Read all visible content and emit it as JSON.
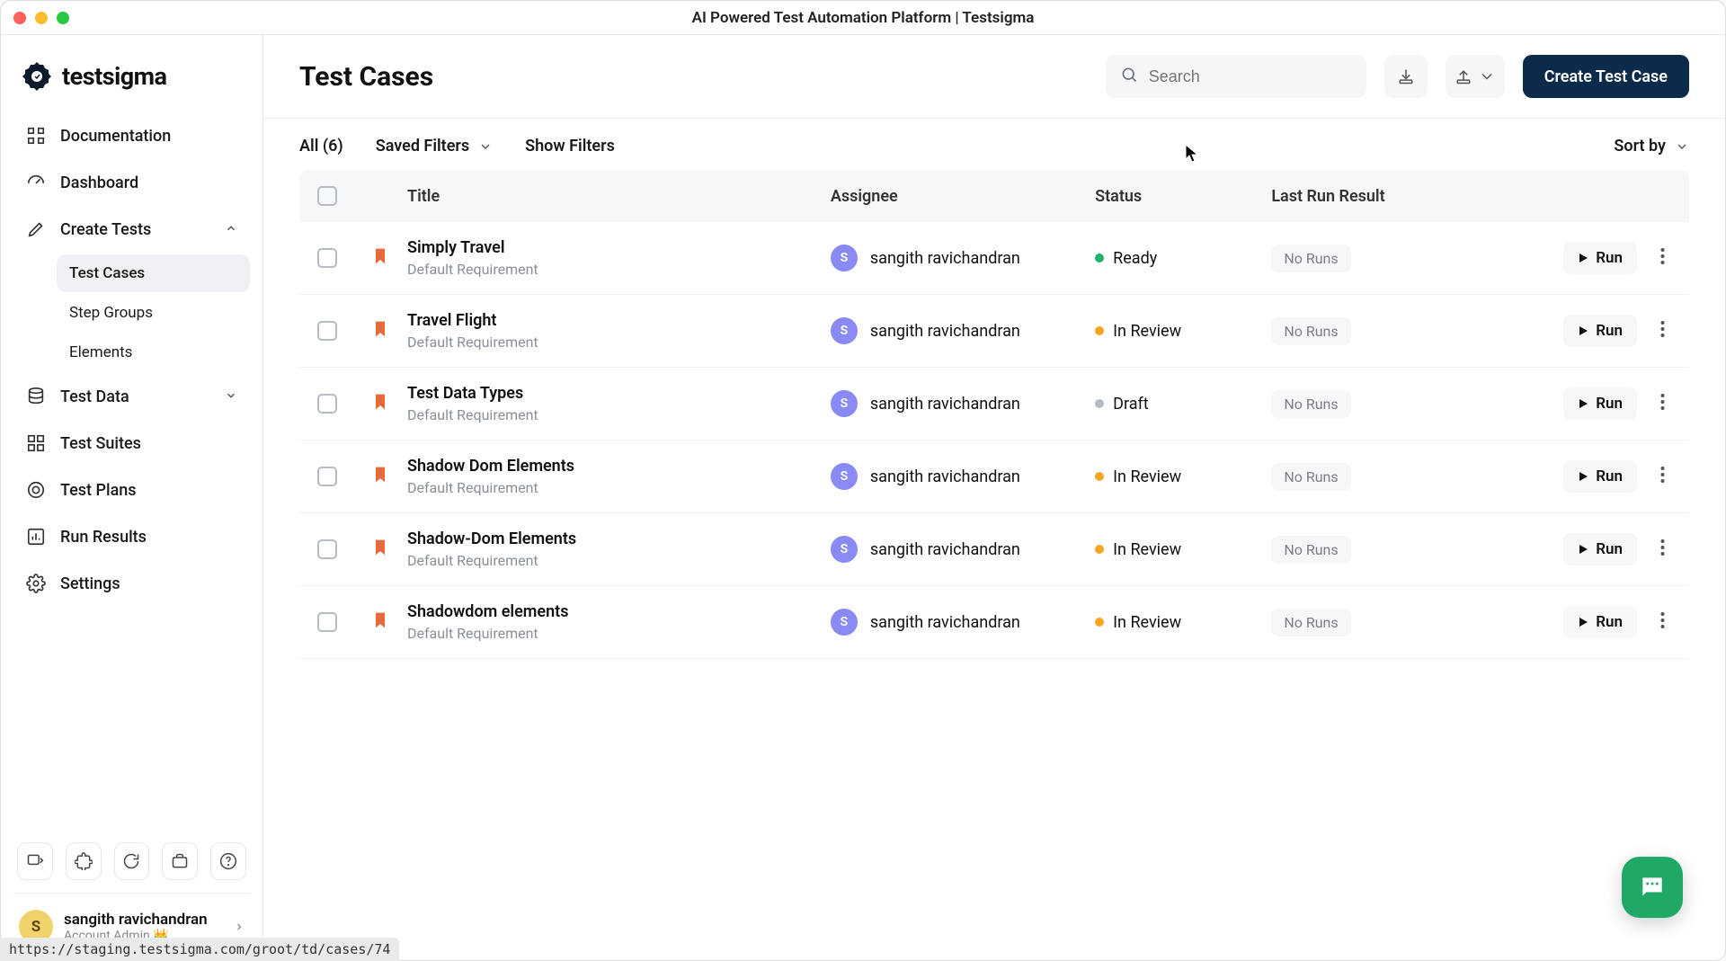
{
  "window": {
    "title": "AI Powered Test Automation Platform | Testsigma"
  },
  "brand": {
    "name": "testsigma"
  },
  "sidebar": {
    "top": [
      {
        "label": "Documentation"
      },
      {
        "label": "Dashboard"
      }
    ],
    "create_tests": {
      "label": "Create Tests"
    },
    "create_tests_children": [
      {
        "label": "Test Cases"
      },
      {
        "label": "Step Groups"
      },
      {
        "label": "Elements"
      }
    ],
    "test_data": {
      "label": "Test Data"
    },
    "rest": [
      {
        "label": "Test Suites"
      },
      {
        "label": "Test Plans"
      },
      {
        "label": "Run Results"
      },
      {
        "label": "Settings"
      }
    ]
  },
  "user": {
    "initial": "S",
    "name": "sangith ravichandran",
    "role": "Account Admin 👑"
  },
  "header": {
    "title": "Test Cases",
    "search_placeholder": "Search",
    "create_btn": "Create Test Case"
  },
  "toolbar": {
    "all": "All (6)",
    "saved_filters": "Saved Filters",
    "show_filters": "Show Filters",
    "sort_by": "Sort by"
  },
  "columns": {
    "title": "Title",
    "assignee": "Assignee",
    "status": "Status",
    "last_run": "Last Run Result"
  },
  "rows": [
    {
      "title": "Simply Travel",
      "sub": "Default Requirement",
      "assignee_initial": "S",
      "assignee": "sangith ravichandran",
      "status": "Ready",
      "status_kind": "ready",
      "result": "No Runs",
      "run": "Run"
    },
    {
      "title": "Travel Flight",
      "sub": "Default Requirement",
      "assignee_initial": "S",
      "assignee": "sangith ravichandran",
      "status": "In Review",
      "status_kind": "review",
      "result": "No Runs",
      "run": "Run"
    },
    {
      "title": "Test Data Types",
      "sub": "Default Requirement",
      "assignee_initial": "S",
      "assignee": "sangith ravichandran",
      "status": "Draft",
      "status_kind": "draft",
      "result": "No Runs",
      "run": "Run"
    },
    {
      "title": "Shadow Dom Elements",
      "sub": "Default Requirement",
      "assignee_initial": "S",
      "assignee": "sangith ravichandran",
      "status": "In Review",
      "status_kind": "review",
      "result": "No Runs",
      "run": "Run"
    },
    {
      "title": "Shadow-Dom Elements",
      "sub": "Default Requirement",
      "assignee_initial": "S",
      "assignee": "sangith ravichandran",
      "status": "In Review",
      "status_kind": "review",
      "result": "No Runs",
      "run": "Run"
    },
    {
      "title": "Shadowdom elements",
      "sub": "Default Requirement",
      "assignee_initial": "S",
      "assignee": "sangith ravichandran",
      "status": "In Review",
      "status_kind": "review",
      "result": "No Runs",
      "run": "Run"
    }
  ],
  "status_url": "https://staging.testsigma.com/groot/td/cases/74"
}
